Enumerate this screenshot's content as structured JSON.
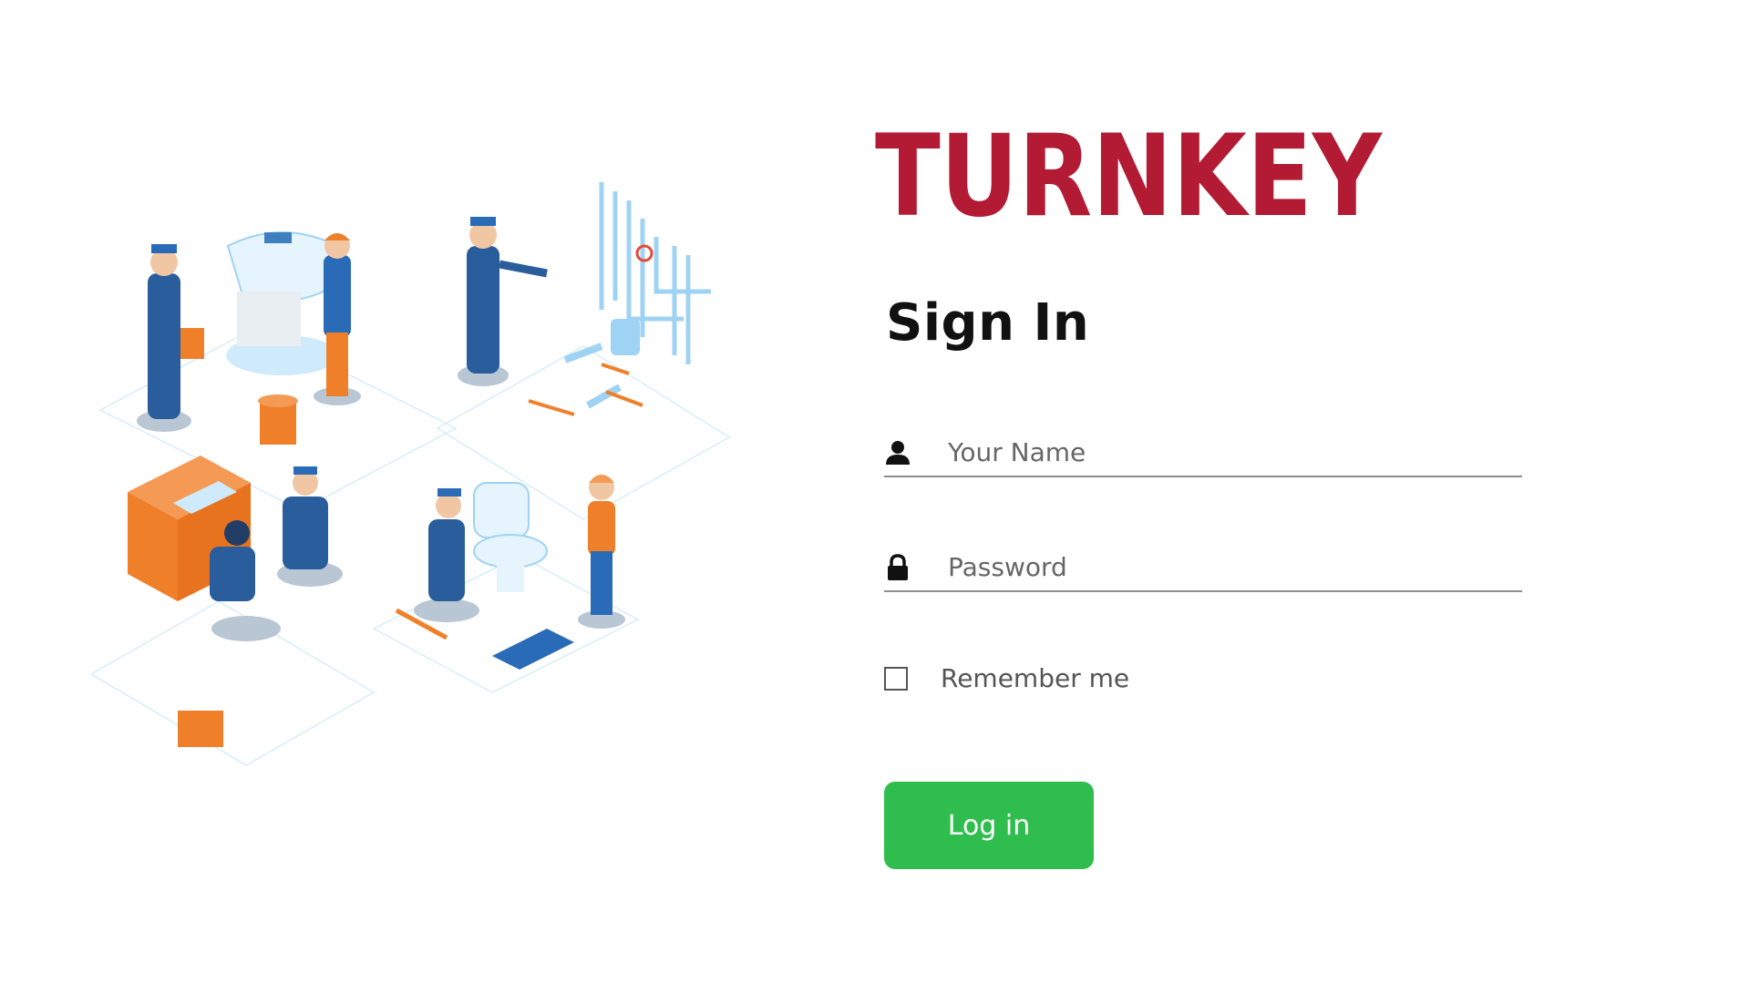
{
  "brand": {
    "logo_text": "TURNKEY",
    "logo_color": "#b31b34"
  },
  "form": {
    "title": "Sign In",
    "name_field": {
      "icon": "user-icon",
      "placeholder": "Your Name",
      "value": ""
    },
    "password_field": {
      "icon": "lock-icon",
      "placeholder": "Password",
      "value": ""
    },
    "remember_label": "Remember me",
    "remember_checked": false,
    "login_label": "Log in",
    "login_color": "#2fbd4d"
  },
  "illustration": {
    "scenes": [
      "leaking-sink",
      "pipe-installation",
      "kitchen-sink-repair",
      "toilet-repair"
    ],
    "accent_colors": [
      "#f07f2a",
      "#2a6bb8",
      "#9fd3f3"
    ]
  }
}
